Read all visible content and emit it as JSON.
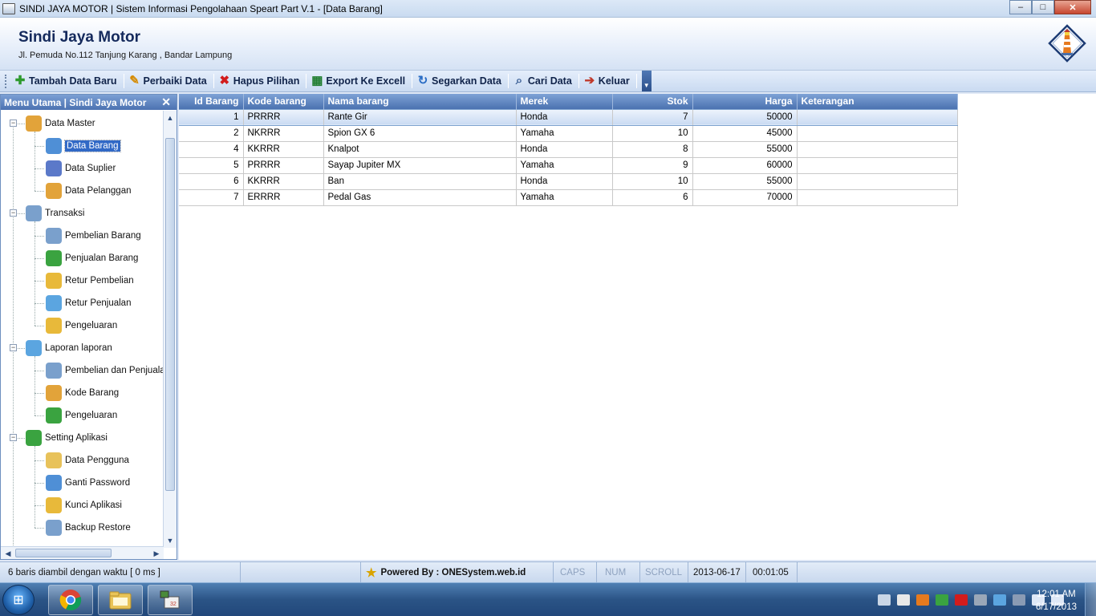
{
  "window": {
    "title": "SINDI JAYA MOTOR | Sistem Informasi Pengolahaan Speart Part V.1 - [Data Barang]",
    "minimize": "–",
    "maximize": "□",
    "close": "✕"
  },
  "header": {
    "company": "Sindi Jaya Motor",
    "address": "Jl. Pemuda No.112  Tanjung Karang , Bandar Lampung"
  },
  "toolbar": {
    "items": [
      {
        "label": "Tambah Data Baru",
        "icon": "plus-icon",
        "glyph": "✚",
        "color": "#2e9a2e"
      },
      {
        "label": "Perbaiki Data",
        "icon": "pencil-icon",
        "glyph": "✎",
        "color": "#d58a00"
      },
      {
        "label": "Hapus Pilihan",
        "icon": "delete-x-icon",
        "glyph": "✖",
        "color": "#d21c1c"
      },
      {
        "label": "Export Ke Excell",
        "icon": "excel-icon",
        "glyph": "▦",
        "color": "#1e7c2e"
      },
      {
        "label": "Segarkan Data",
        "icon": "refresh-icon",
        "glyph": "↻",
        "color": "#2a6cc4"
      },
      {
        "label": "Cari Data",
        "icon": "magnifier-icon",
        "glyph": "⌕",
        "color": "#3b5f96"
      },
      {
        "label": "Keluar",
        "icon": "exit-icon",
        "glyph": "➔",
        "color": "#c0392b"
      }
    ]
  },
  "sidebar": {
    "title": "Menu Utama | Sindi Jaya Motor",
    "close": "✕",
    "groups": [
      {
        "label": "Data Master",
        "expander": "−",
        "color": "#e2a33a",
        "items": [
          {
            "label": "Data Barang",
            "color": "#4f8fd6",
            "selected": true
          },
          {
            "label": "Data Suplier",
            "color": "#5b79c9"
          },
          {
            "label": "Data Pelanggan",
            "color": "#e2a33a"
          }
        ]
      },
      {
        "label": "Transaksi",
        "expander": "−",
        "color": "#7aa0cc",
        "items": [
          {
            "label": "Pembelian Barang",
            "color": "#7aa0cc"
          },
          {
            "label": "Penjualan Barang",
            "color": "#3aa340"
          },
          {
            "label": "Retur Pembelian",
            "color": "#e8b93a"
          },
          {
            "label": "Retur Penjualan",
            "color": "#5ba5e0"
          },
          {
            "label": "Pengeluaran",
            "color": "#e8b93a"
          }
        ]
      },
      {
        "label": "Laporan laporan",
        "expander": "−",
        "color": "#5ba5e0",
        "items": [
          {
            "label": "Pembelian dan Penjualan",
            "color": "#7aa0cc"
          },
          {
            "label": "Kode Barang",
            "color": "#e2a33a"
          },
          {
            "label": "Pengeluaran",
            "color": "#3aa340"
          }
        ]
      },
      {
        "label": "Setting Aplikasi",
        "expander": "−",
        "color": "#3aa340",
        "items": [
          {
            "label": "Data Pengguna",
            "color": "#e8c25a"
          },
          {
            "label": "Ganti Password",
            "color": "#4f8fd6"
          },
          {
            "label": "Kunci Aplikasi",
            "color": "#e8b93a"
          },
          {
            "label": "Backup  Restore",
            "color": "#7aa0cc"
          }
        ]
      }
    ]
  },
  "grid": {
    "columns": [
      "Id Barang",
      "Kode barang",
      "Nama barang",
      "Merek",
      "Stok",
      "Harga",
      "Keterangan"
    ],
    "rows": [
      [
        "1",
        "PRRRR",
        "Rante Gir",
        "Honda",
        "7",
        "50000",
        ""
      ],
      [
        "2",
        "NKRRR",
        "Spion GX 6",
        "Yamaha",
        "10",
        "45000",
        ""
      ],
      [
        "4",
        "KKRRR",
        "Knalpot",
        "Honda",
        "8",
        "55000",
        ""
      ],
      [
        "5",
        "PRRRR",
        "Sayap Jupiter MX",
        "Yamaha",
        "9",
        "60000",
        ""
      ],
      [
        "6",
        "KKRRR",
        "Ban",
        "Honda",
        "10",
        "55000",
        ""
      ],
      [
        "7",
        "ERRRR",
        "Pedal Gas",
        "Yamaha",
        "6",
        "70000",
        ""
      ]
    ],
    "selected_row": 0
  },
  "statusbar": {
    "info": "6 baris diambil dengan waktu [ 0 ms ]",
    "powered": "Powered By : ONESystem.web.id",
    "caps": "CAPS",
    "num": "NUM",
    "scroll": "SCROLL",
    "date": "2013-06-17",
    "time": "00:01:05"
  },
  "taskbar": {
    "clock_time": "12:01 AM",
    "clock_date": "6/17/2013"
  }
}
